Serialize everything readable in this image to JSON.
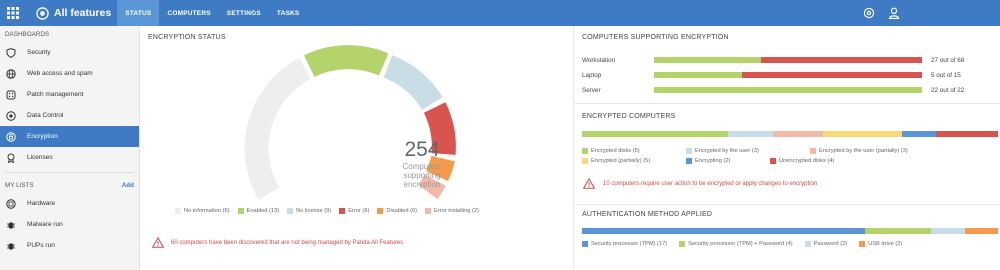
{
  "topbar": {
    "brand": "All features",
    "tabs": [
      {
        "label": "STATUS",
        "active": true
      },
      {
        "label": "COMPUTERS",
        "active": false
      },
      {
        "label": "SETTINGS",
        "active": false
      },
      {
        "label": "TASKS",
        "active": false
      }
    ],
    "icons": [
      "apps-grid-icon",
      "gear-icon",
      "user-icon"
    ]
  },
  "sidebar": {
    "dashboards_heading": "DASHBOARDS",
    "dashboards": [
      {
        "label": "Security",
        "icon": "shield-icon"
      },
      {
        "label": "Web access and spam",
        "icon": "globe-icon"
      },
      {
        "label": "Patch management",
        "icon": "patch-icon"
      },
      {
        "label": "Data Control",
        "icon": "data-control-icon"
      },
      {
        "label": "Encryption",
        "icon": "encryption-icon",
        "active": true
      },
      {
        "label": "Licenses",
        "icon": "license-icon"
      }
    ],
    "lists_heading": "MY LISTS",
    "lists_add": "Add",
    "lists": [
      {
        "label": "Hardware",
        "icon": "hardware-icon"
      },
      {
        "label": "Malware run",
        "icon": "malware-icon"
      },
      {
        "label": "PUPs run",
        "icon": "pup-icon"
      }
    ]
  },
  "encryption_status": {
    "title": "ENCRYPTION STATUS",
    "center_number": "254",
    "center_line1": "Computers",
    "center_line2": "supporting",
    "center_line3": "encryption",
    "legend": [
      {
        "label": "No information (6)",
        "color": "#eeeeee"
      },
      {
        "label": "Enabled (13)",
        "color": "#b5d36b"
      },
      {
        "label": "No license (9)",
        "color": "#c8dde6"
      },
      {
        "label": "Error (6)",
        "color": "#d9534f"
      },
      {
        "label": "Disabled (6)",
        "color": "#f59a4a"
      },
      {
        "label": "Error installing (2)",
        "color": "#f2b8a8"
      }
    ],
    "alert_text": "60 computers have been discovered that are not being managed by Panda All Features"
  },
  "supporting": {
    "title": "COMPUTERS SUPPORTING ENCRYPTION",
    "rows": [
      {
        "label": "Workstation",
        "value": "27 out of 68",
        "green_fraction": 0.4
      },
      {
        "label": "Laptop",
        "value": "5 out of 15",
        "green_fraction": 0.33
      },
      {
        "label": "Server",
        "value": "22 out of 22",
        "green_fraction": 1.0
      }
    ],
    "colors": {
      "supported": "#b5d36b",
      "unsupported": "#d9534f"
    }
  },
  "encrypted_computers": {
    "title": "ENCRYPTED COMPUTERS",
    "segments": [
      {
        "color": "#b5d36b",
        "fraction": 0.35
      },
      {
        "color": "#c8dde6",
        "fraction": 0.11
      },
      {
        "color": "#f2b8a8",
        "fraction": 0.12
      },
      {
        "color": "#f9d97a",
        "fraction": 0.19
      },
      {
        "color": "#5a95d6",
        "fraction": 0.08
      },
      {
        "color": "#d9534f",
        "fraction": 0.15
      }
    ],
    "legend_row1": [
      {
        "label": "Encrypted disks (5)",
        "color": "#b5d36b"
      },
      {
        "label": "Encrypted by the user (3)",
        "color": "#c8dde6"
      },
      {
        "label": "Encrypted by the user (partially) (3)",
        "color": "#f2b8a8"
      }
    ],
    "legend_row2": [
      {
        "label": "Encrypted (partially) (5)",
        "color": "#f9d97a"
      },
      {
        "label": "Encrypting (2)",
        "color": "#5a95d6"
      },
      {
        "label": "Unencrypted disks (4)",
        "color": "#d9534f"
      }
    ],
    "alert_text": "10 computers require user action to be encrypted or apply changes to encryption"
  },
  "authentication": {
    "title": "AUTHENTICATION METHOD APPLIED",
    "segments": [
      {
        "color": "#5a95d6",
        "fraction": 0.68
      },
      {
        "color": "#b5d36b",
        "fraction": 0.16
      },
      {
        "color": "#c8dde6",
        "fraction": 0.08
      },
      {
        "color": "#f59a4a",
        "fraction": 0.08
      }
    ],
    "legend": [
      {
        "label": "Security processor (TPM) (17)",
        "color": "#5a95d6"
      },
      {
        "label": "Security processor (TPM) + Password (4)",
        "color": "#b5d36b"
      },
      {
        "label": "Password (2)",
        "color": "#c8dde6"
      },
      {
        "label": "USB drive (2)",
        "color": "#f59a4a"
      }
    ]
  }
}
